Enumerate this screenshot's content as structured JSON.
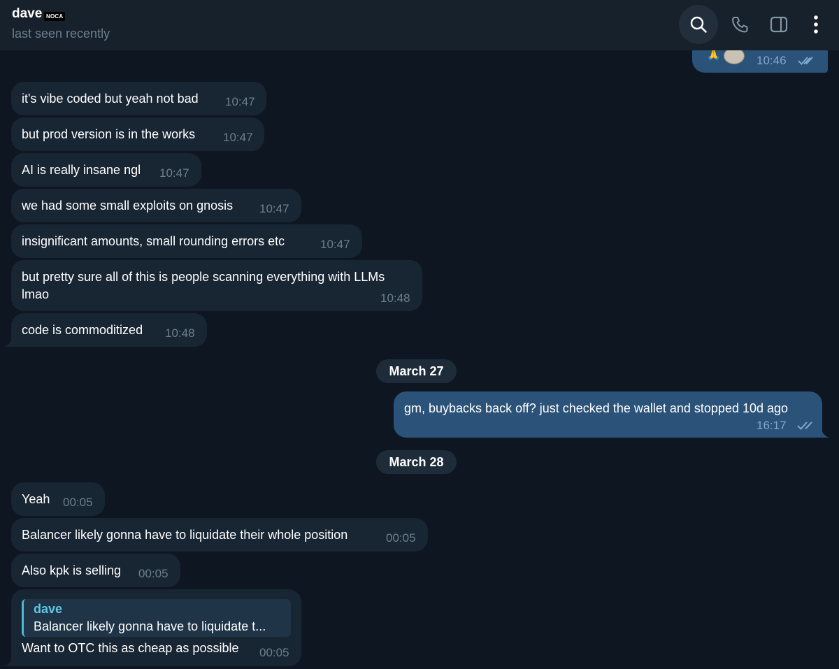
{
  "header": {
    "contact_name": "dave",
    "contact_badge": "NOCA",
    "status": "last seen recently",
    "icons": [
      "search-icon",
      "phone-icon",
      "sidebar-toggle-icon",
      "more-vertical-icon"
    ]
  },
  "top_partial_message": {
    "emoji": "🙏",
    "time": "10:46"
  },
  "messages_group1": [
    {
      "text": "it's vibe coded but yeah not bad",
      "time": "10:47"
    },
    {
      "text": "but prod version is in the works",
      "time": "10:47"
    },
    {
      "text": "AI is really insane ngl",
      "time": "10:47"
    },
    {
      "text": "we had some small exploits on gnosis",
      "time": "10:47"
    },
    {
      "text": "insignificant amounts, small rounding errors etc",
      "time": "10:47"
    },
    {
      "text_line1": "but pretty sure all of this is people scanning everything with LLMs",
      "text_line2": "lmao",
      "time": "10:48"
    },
    {
      "text": "code is commoditized",
      "time": "10:48"
    }
  ],
  "date_separators": [
    "March 27",
    "March 28"
  ],
  "outgoing_message": {
    "text": "gm, buybacks back off? just checked the wallet and stopped 10d ago",
    "time": "16:17"
  },
  "messages_group2": [
    {
      "text": "Yeah",
      "time": "00:05"
    },
    {
      "text": "Balancer likely gonna have to liquidate their whole position",
      "time": "00:05"
    },
    {
      "text": "Also kpk is selling",
      "time": "00:05"
    }
  ],
  "reply_message": {
    "reply_author": "dave",
    "reply_preview": "Balancer likely gonna have to liquidate t...",
    "text": "Want to OTC this as cheap as possible",
    "time": "00:05"
  },
  "colors": {
    "background": "#0e1621",
    "header": "#17212b",
    "incoming_bubble": "#182533",
    "outgoing_bubble": "#2b5278",
    "accent": "#5fc6e6"
  }
}
